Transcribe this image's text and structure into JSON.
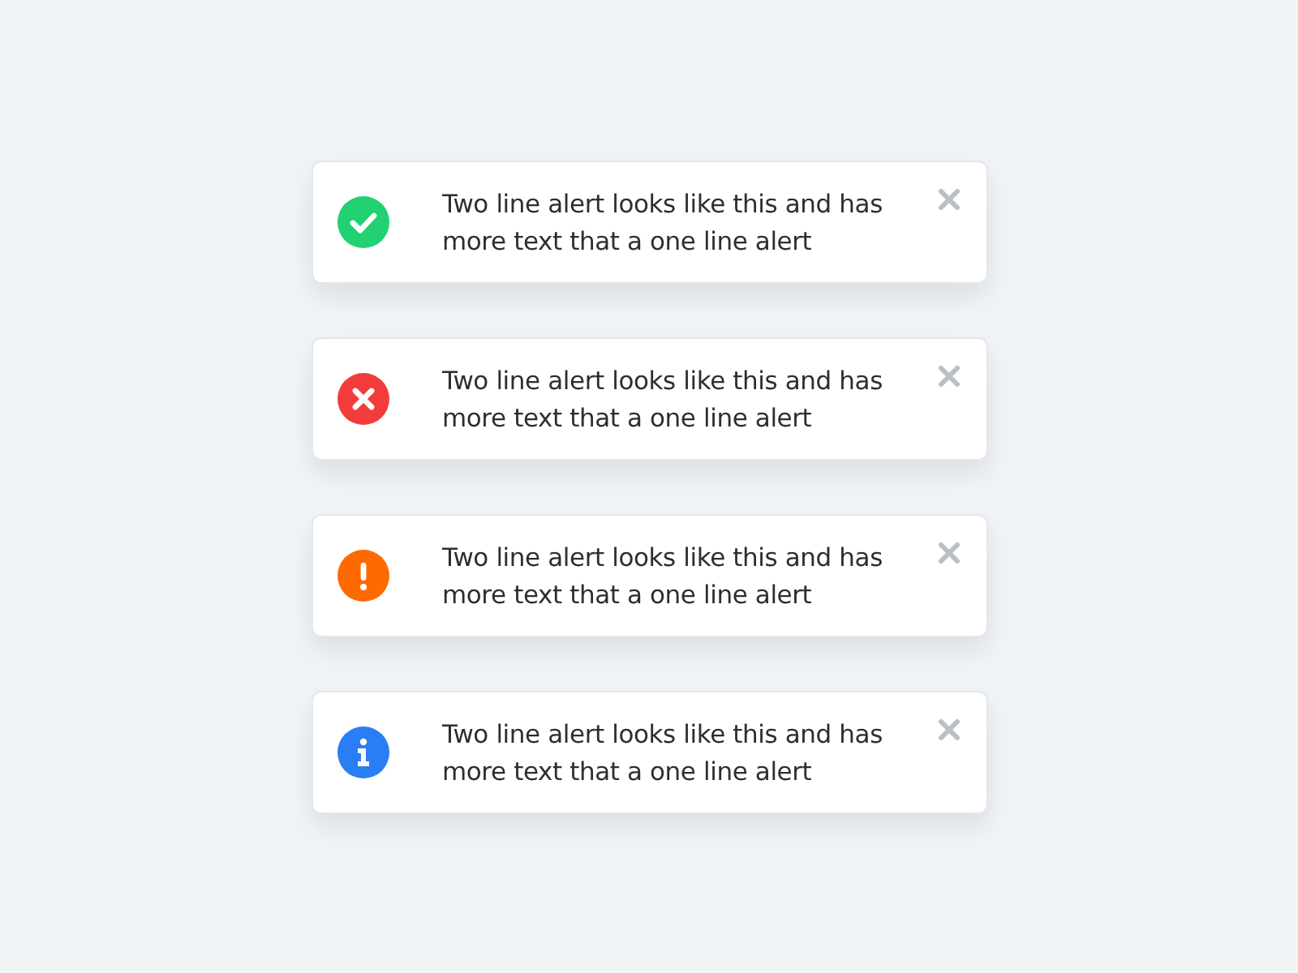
{
  "alerts": [
    {
      "kind": "success",
      "color": "#22d172",
      "message": "Two line alert looks like this and has more text that a one line alert"
    },
    {
      "kind": "error",
      "color": "#f23c3c",
      "message": "Two line alert looks like this and has more text that a one line alert"
    },
    {
      "kind": "warning",
      "color": "#ff6a00",
      "message": "Two line alert looks like this and has more text that a one line alert"
    },
    {
      "kind": "info",
      "color": "#2a7ef5",
      "message": "Two line alert looks like this and has more text that a one line alert"
    }
  ]
}
